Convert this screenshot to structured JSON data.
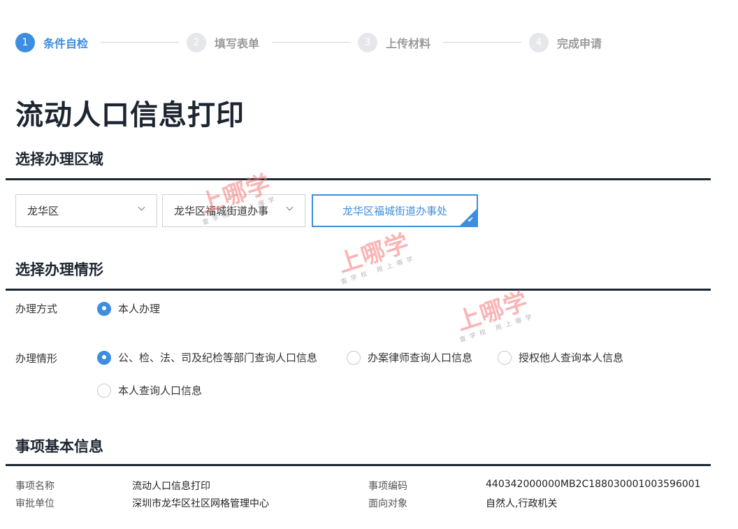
{
  "steps": [
    {
      "num": "1",
      "label": "条件自检",
      "active": true
    },
    {
      "num": "2",
      "label": "填写表单",
      "active": false
    },
    {
      "num": "3",
      "label": "上传材料",
      "active": false
    },
    {
      "num": "4",
      "label": "完成申请",
      "active": false
    }
  ],
  "page_title": "流动人口信息打印",
  "region": {
    "heading": "选择办理区域",
    "district_select": "龙华区",
    "street_select": "龙华区福城街道办事",
    "selected_office": "龙华区福城街道办事处"
  },
  "situation": {
    "heading": "选择办理情形",
    "method_label": "办理方式",
    "method_options": [
      {
        "label": "本人办理",
        "checked": true
      }
    ],
    "case_label": "办理情形",
    "case_options": [
      {
        "label": "公、检、法、司及纪检等部门查询人口信息",
        "checked": true
      },
      {
        "label": "办案律师查询人口信息",
        "checked": false
      },
      {
        "label": "授权他人查询本人信息",
        "checked": false
      },
      {
        "label": "本人查询人口信息",
        "checked": false
      }
    ]
  },
  "basic_info": {
    "heading": "事项基本信息",
    "rows": [
      {
        "label1": "事项名称",
        "value1": "流动人口信息打印",
        "label2": "事项编码",
        "value2": "440342000000MB2C188030001003596001"
      },
      {
        "label1": "审批单位",
        "value1": "深圳市龙华区社区网格管理中心",
        "label2": "面向对象",
        "value2": "自然人,行政机关"
      }
    ]
  },
  "watermark": {
    "main": "上哪学",
    "sub": "查学校 用上哪学"
  },
  "colors": {
    "accent": "#3d8ee0",
    "heading": "#1c2530",
    "inactive_step": "#e6e7ea"
  }
}
